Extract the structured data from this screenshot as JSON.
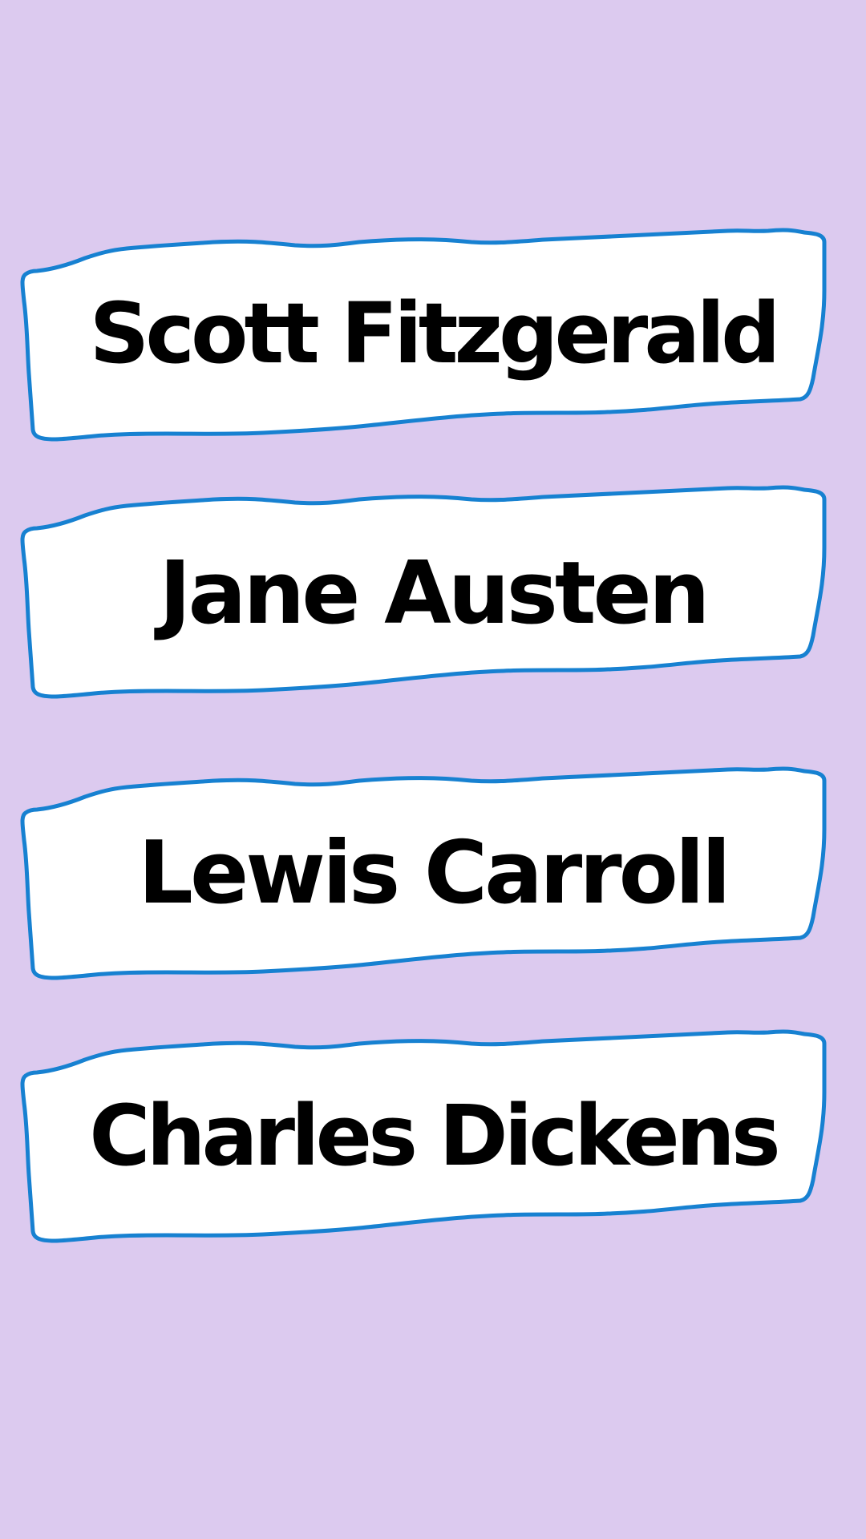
{
  "colors": {
    "background": "#dccaef",
    "card_fill": "#ffffff",
    "card_border": "#1781d1",
    "text": "#000000"
  },
  "options": [
    {
      "label": "Scott Fitzgerald"
    },
    {
      "label": "Jane Austen"
    },
    {
      "label": "Lewis Carroll"
    },
    {
      "label": "Charles Dickens"
    }
  ]
}
